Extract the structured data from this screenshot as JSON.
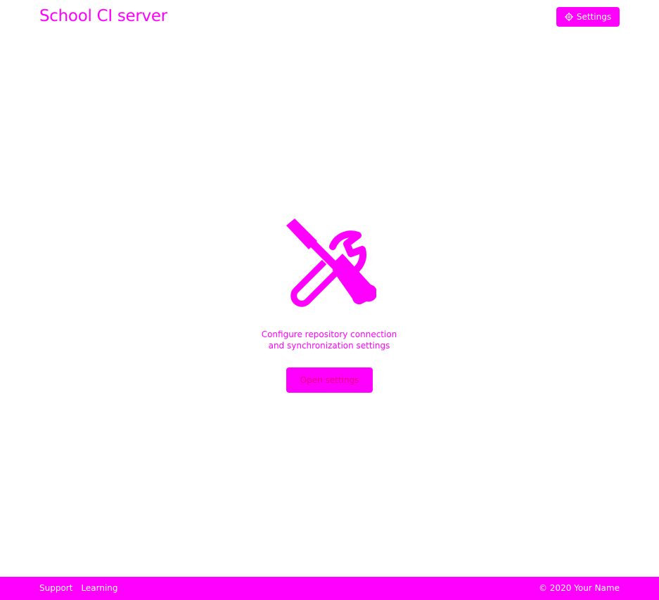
{
  "header": {
    "title": "School CI server",
    "settings_label": "Settings",
    "settings_icon": "gear-icon"
  },
  "main": {
    "icon": "tools-icon",
    "message_line1": "Configure repository connection",
    "message_line2": "and synchronization settings",
    "open_settings_label": "Open settings"
  },
  "footer": {
    "links": [
      "Support",
      "Learning"
    ],
    "copyright": "© 2020 Your Name"
  },
  "colors": {
    "accent": "#ff00ff",
    "background": "#ffffff"
  }
}
